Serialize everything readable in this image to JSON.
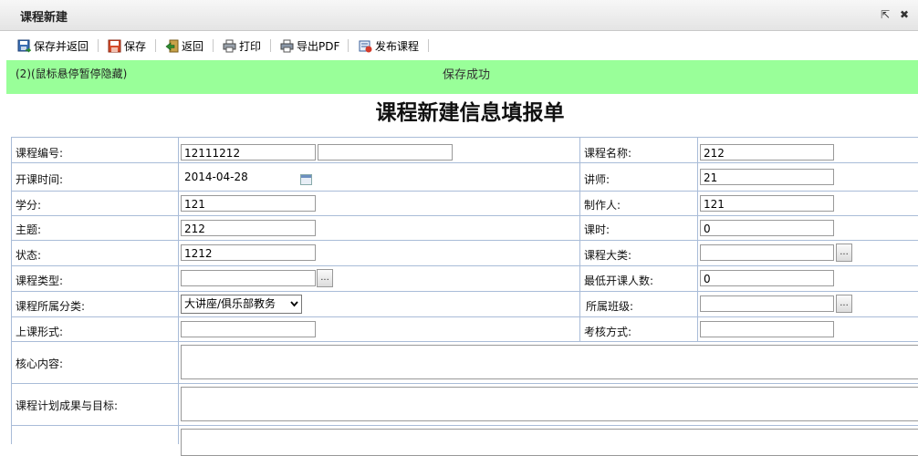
{
  "window": {
    "title": "课程新建",
    "popout_icon": "⇱",
    "close_icon": "✖"
  },
  "toolbar": [
    {
      "label": "保存并返回",
      "icon": "save-return-icon"
    },
    {
      "label": "保存",
      "icon": "save-icon"
    },
    {
      "label": "返回",
      "icon": "back-icon"
    },
    {
      "label": "打印",
      "icon": "print-icon"
    },
    {
      "label": "导出PDF",
      "icon": "pdf-export-icon"
    },
    {
      "label": "发布课程",
      "icon": "publish-icon"
    }
  ],
  "banner": {
    "hint": "(2)(鼠标悬停暂停隐藏)",
    "message": "保存成功",
    "color": "#99ff99"
  },
  "form": {
    "title": "课程新建信息填报单",
    "course_no_label": "课程编号:",
    "course_no_value": "12111212",
    "course_no_value2": "",
    "course_name_label": "课程名称:",
    "course_name_value": "212",
    "start_time_label": "开课时间:",
    "start_time_value": "2014-04-28",
    "lecturer_label": "讲师:",
    "lecturer_value": "21",
    "credit_label": "学分:",
    "credit_value": "121",
    "maker_label": "制作人:",
    "maker_value": "121",
    "topic_label": "主题:",
    "topic_value": "212",
    "hours_label": "课时:",
    "hours_value": "0",
    "status_label": "状态:",
    "status_value": "1212",
    "category_label": "课程大类:",
    "category_value": "",
    "type_label": "课程类型:",
    "type_value": "",
    "min_people_label": "最低开课人数:",
    "min_people_value": "0",
    "group_label": "课程所属分类:",
    "group_value": "大讲座/俱乐部教务",
    "class_label": "所属班级:",
    "class_value": "",
    "mode_label": "上课形式:",
    "mode_value": "",
    "exam_label": "考核方式:",
    "exam_value": "",
    "core_label": "核心内容:",
    "plan_label": "课程计划成果与目标:",
    "browse_label": "..."
  },
  "colors": {
    "grid_border": "#a9bcd8",
    "banner_bg": "#99ff99"
  }
}
